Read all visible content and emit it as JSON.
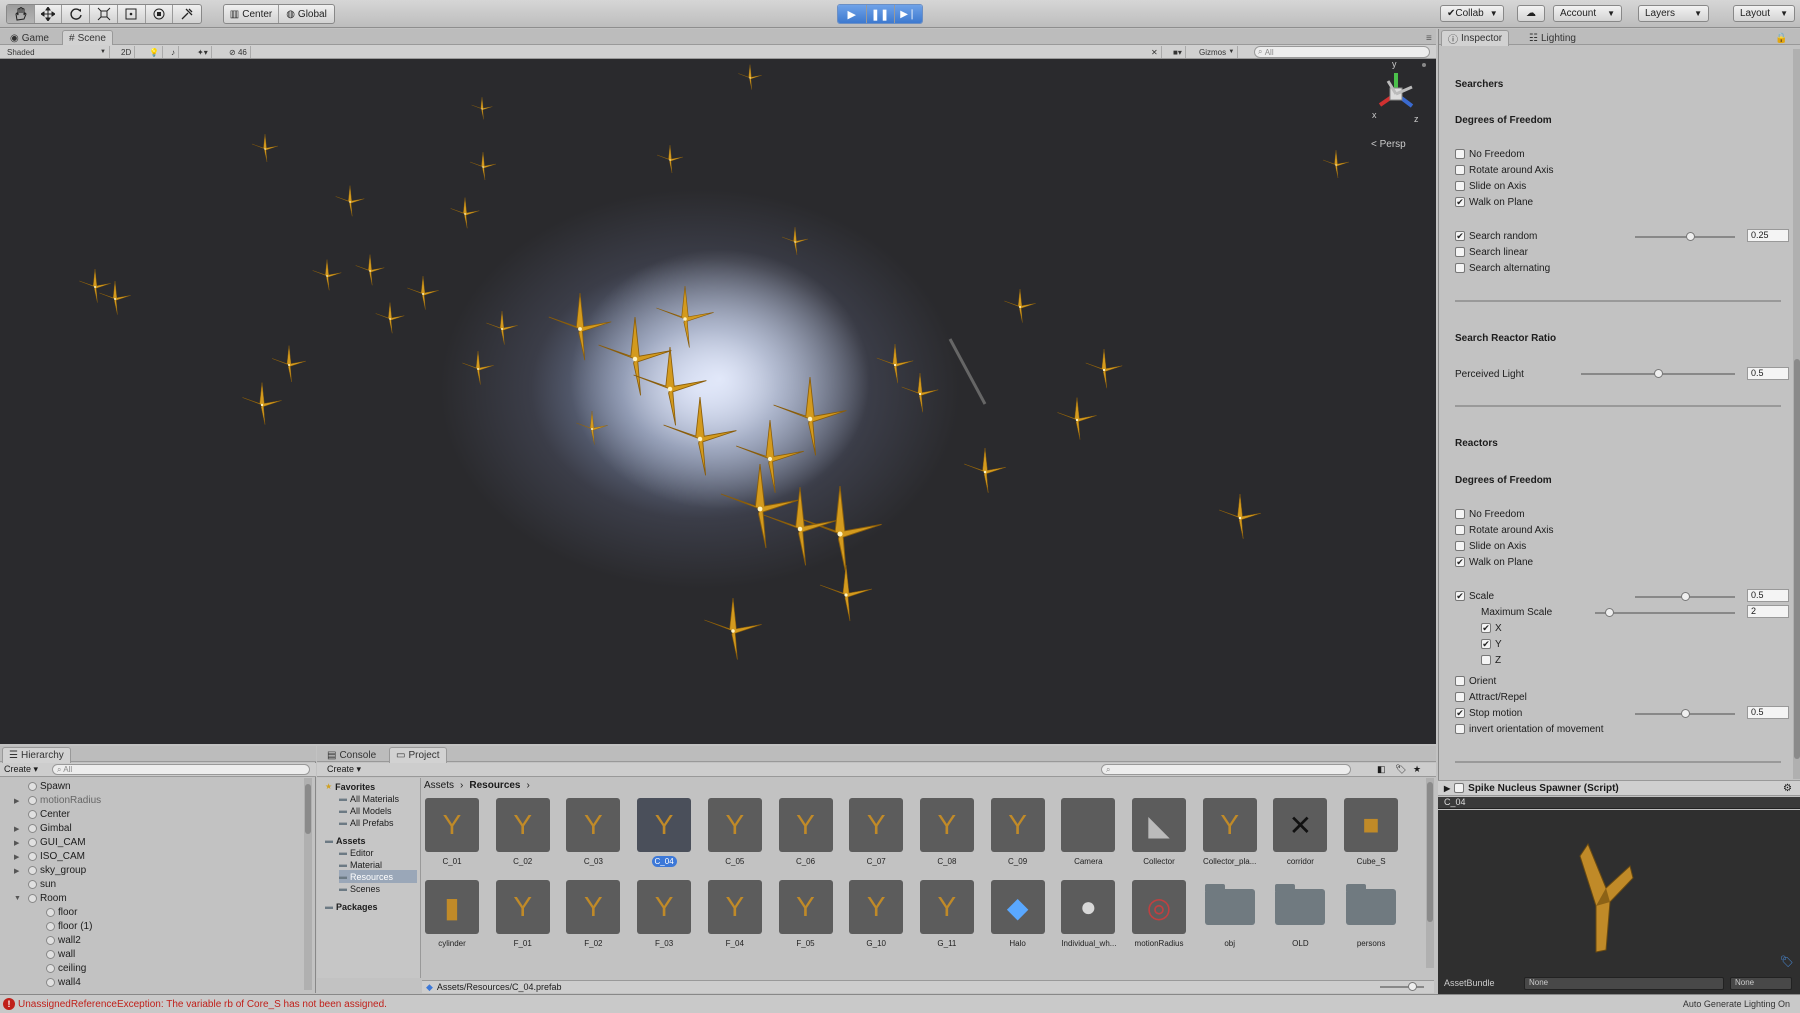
{
  "toolbar": {
    "pivot_center": "Center",
    "pivot_global": "Global",
    "collab": "Collab",
    "account": "Account",
    "layers": "Layers",
    "layout": "Layout"
  },
  "scene_tabs": {
    "game": "Game",
    "scene": "Scene"
  },
  "scene_bar": {
    "shaded": "Shaded",
    "mode_2d": "2D",
    "hidden_count": "46",
    "gizmos": "Gizmos",
    "search_placeholder": "All"
  },
  "gizmo": {
    "x": "x",
    "y": "y",
    "z": "z",
    "persp": "Persp"
  },
  "inspector": {
    "tab_inspector": "Inspector",
    "tab_lighting": "Lighting",
    "searchers_header": "Searchers",
    "dof_header_1": "Degrees of Freedom",
    "searcher_options": [
      {
        "label": "No Freedom",
        "checked": false
      },
      {
        "label": "Rotate around Axis",
        "checked": false
      },
      {
        "label": "Slide on Axis",
        "checked": false
      },
      {
        "label": "Walk on Plane",
        "checked": true
      }
    ],
    "search_random": {
      "label": "Search random",
      "checked": true,
      "value": "0.25",
      "fraction": 0.55
    },
    "search_linear": "Search linear",
    "search_alternating": "Search alternating",
    "ratio_header": "Search Reactor Ratio",
    "perceived_light": {
      "label": "Perceived Light",
      "value": "0.5",
      "fraction": 0.5
    },
    "reactors_header": "Reactors",
    "dof_header_2": "Degrees of Freedom",
    "reactor_options": [
      {
        "label": "No Freedom",
        "checked": false
      },
      {
        "label": "Rotate around Axis",
        "checked": false
      },
      {
        "label": "Slide on Axis",
        "checked": false
      },
      {
        "label": "Walk on Plane",
        "checked": true
      }
    ],
    "scale": {
      "label": "Scale",
      "checked": true,
      "value": "0.5",
      "fraction": 0.5
    },
    "max_scale": {
      "label": "Maximum Scale",
      "value": "2",
      "fraction": 0.1
    },
    "axes": [
      {
        "label": "X",
        "checked": true
      },
      {
        "label": "Y",
        "checked": true
      },
      {
        "label": "Z",
        "checked": false
      }
    ],
    "orient": "Orient",
    "attract": "Attract/Repel",
    "stop_motion": {
      "label": "Stop motion",
      "checked": true,
      "value": "0.5",
      "fraction": 0.5
    },
    "invert": "invert orientation of movement",
    "component": "Spike Nucleus Spawner (Script)",
    "preview_title": "C_04",
    "assetbundle_label": "AssetBundle",
    "assetbundle_value": "None",
    "assetbundle_variant": "None"
  },
  "hierarchy": {
    "tab": "Hierarchy",
    "create": "Create",
    "search_placeholder": "All",
    "items": [
      {
        "label": "Spawn",
        "indent": 0,
        "arrow": false
      },
      {
        "label": "motionRadius",
        "indent": 0,
        "arrow": true,
        "dim": true
      },
      {
        "label": "Center",
        "indent": 0,
        "arrow": false
      },
      {
        "label": "Gimbal",
        "indent": 0,
        "arrow": true
      },
      {
        "label": "GUI_CAM",
        "indent": 0,
        "arrow": true
      },
      {
        "label": "ISO_CAM",
        "indent": 0,
        "arrow": true
      },
      {
        "label": "sky_group",
        "indent": 0,
        "arrow": true
      },
      {
        "label": "sun",
        "indent": 0,
        "arrow": false
      },
      {
        "label": "Room",
        "indent": 0,
        "arrow": true,
        "open": true
      },
      {
        "label": "floor",
        "indent": 1,
        "arrow": false
      },
      {
        "label": "floor (1)",
        "indent": 1,
        "arrow": false
      },
      {
        "label": "wall2",
        "indent": 1,
        "arrow": false
      },
      {
        "label": "wall",
        "indent": 1,
        "arrow": false
      },
      {
        "label": "ceiling",
        "indent": 1,
        "arrow": false
      },
      {
        "label": "wall4",
        "indent": 1,
        "arrow": false
      }
    ]
  },
  "project": {
    "tab_console": "Console",
    "tab_project": "Project",
    "create": "Create",
    "breadcrumb_root": "Assets",
    "breadcrumb_leaf": "Resources",
    "tree": [
      {
        "label": "Favorites",
        "bold": true,
        "indent": 0
      },
      {
        "label": "All Materials",
        "indent": 1
      },
      {
        "label": "All Models",
        "indent": 1
      },
      {
        "label": "All Prefabs",
        "indent": 1
      },
      {
        "label": "Assets",
        "bold": true,
        "indent": 0
      },
      {
        "label": "Editor",
        "indent": 1
      },
      {
        "label": "Material",
        "indent": 1
      },
      {
        "label": "Resources",
        "indent": 1,
        "selected": true
      },
      {
        "label": "Scenes",
        "indent": 1
      },
      {
        "label": "Packages",
        "bold": true,
        "indent": 0
      }
    ],
    "assets_row1": [
      "C_01",
      "C_02",
      "C_03",
      "C_04",
      "C_05",
      "C_06",
      "C_07",
      "C_08",
      "C_09",
      "Camera",
      "Collector",
      "Collector_pla...",
      "corridor",
      "Cube_S"
    ],
    "assets_row2": [
      "cylinder",
      "F_01",
      "F_02",
      "F_03",
      "F_04",
      "F_05",
      "G_10",
      "G_11",
      "Halo",
      "Individual_wh...",
      "motionRadius",
      "obj",
      "OLD",
      "persons"
    ],
    "selected_asset": "C_04",
    "path": "Assets/Resources/C_04.prefab"
  },
  "status": {
    "error": "UnassignedReferenceException: The variable rb of Core_S has not been assigned.",
    "right": "Auto Generate Lighting On"
  },
  "colors": {
    "accent": "#3c78d8",
    "spike": "#d39a1e",
    "error": "#c0201a"
  }
}
